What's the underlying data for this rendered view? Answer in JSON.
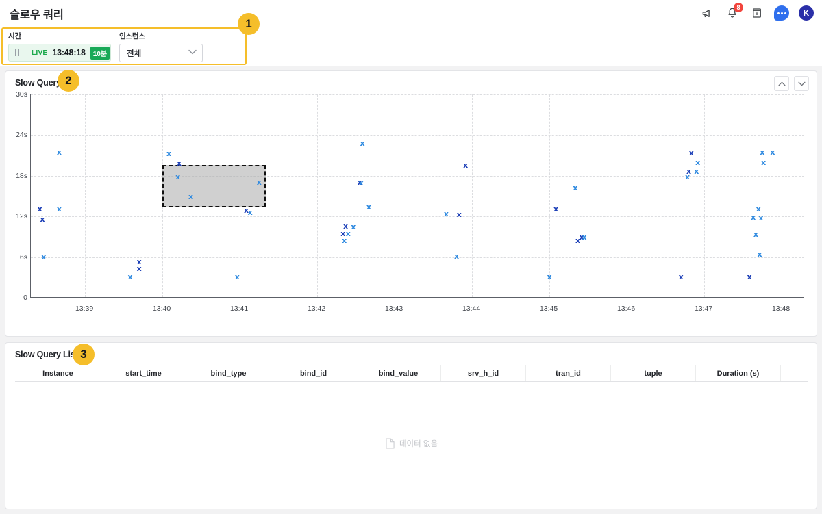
{
  "header": {
    "title": "슬로우 쿼리",
    "icons": [
      {
        "name": "megaphone-icon",
        "glyph": "megaphone"
      },
      {
        "name": "notification-bell-icon",
        "glyph": "bell",
        "badge": "8"
      },
      {
        "name": "guide-book-icon",
        "glyph": "book"
      },
      {
        "name": "chat-icon",
        "glyph": "chat"
      },
      {
        "name": "user-avatar",
        "glyph": "K"
      }
    ]
  },
  "filters": {
    "time": {
      "label": "시간",
      "pause_label": "pause",
      "live_label": "LIVE",
      "current_time": "13:48:18",
      "range_badge": "10분"
    },
    "instance": {
      "label": "인스턴스",
      "value": "전체",
      "options": [
        "전체"
      ]
    }
  },
  "steps": [
    {
      "number": "1"
    },
    {
      "number": "2"
    },
    {
      "number": "3"
    }
  ],
  "chart_panel": {
    "title": "Slow Query",
    "scroll_up_label": "∧",
    "scroll_down_label": "∨"
  },
  "list_panel": {
    "title": "Slow Query List",
    "columns": [
      "Instance",
      "start_time",
      "bind_type",
      "bind_id",
      "bind_value",
      "srv_h_id",
      "tran_id",
      "tuple",
      "Duration (s)",
      ""
    ],
    "empty_text": "데이터 없음"
  },
  "colors": {
    "accent": "#F5BE2A",
    "point_light": "#2f8ae0",
    "point_dark": "#1c3fb7",
    "live_green": "#1ca94c",
    "badge_red": "#f2453d",
    "avatar_blue": "#2a2fa8"
  },
  "chart_data": {
    "type": "scatter",
    "title": "Slow Query",
    "xlabel": "",
    "ylabel": "",
    "grid": true,
    "legend": false,
    "marker": "x",
    "xlim": [
      "13:38:18",
      "13:48:18"
    ],
    "ylim": [
      0,
      30
    ],
    "x_ticks": [
      "13:39",
      "13:40",
      "13:41",
      "13:42",
      "13:43",
      "13:44",
      "13:45",
      "13:46",
      "13:47",
      "13:48"
    ],
    "y_ticks": [
      "0",
      "6s",
      "12s",
      "18s",
      "24s",
      "30s"
    ],
    "y_tick_values": [
      0,
      6,
      12,
      18,
      24,
      30
    ],
    "selection": {
      "x0": "13:40:00",
      "x1": "13:41:20",
      "y0": 13.3,
      "y1": 19.6
    },
    "series": [
      {
        "name": "slow queries",
        "points": [
          {
            "t": "13:38:40",
            "v": 21.5,
            "c": "light"
          },
          {
            "t": "13:38:25",
            "v": 13.1,
            "c": "dark"
          },
          {
            "t": "13:38:40",
            "v": 13.1,
            "c": "light"
          },
          {
            "t": "13:38:27",
            "v": 11.6,
            "c": "dark"
          },
          {
            "t": "13:38:28",
            "v": 6.0,
            "c": "light"
          },
          {
            "t": "13:39:42",
            "v": 5.3,
            "c": "dark"
          },
          {
            "t": "13:39:42",
            "v": 4.3,
            "c": "dark"
          },
          {
            "t": "13:39:35",
            "v": 3.1,
            "c": "light"
          },
          {
            "t": "13:40:05",
            "v": 21.3,
            "c": "light"
          },
          {
            "t": "13:40:13",
            "v": 19.8,
            "c": "dark"
          },
          {
            "t": "13:40:12",
            "v": 17.8,
            "c": "light"
          },
          {
            "t": "13:40:22",
            "v": 14.9,
            "c": "light"
          },
          {
            "t": "13:41:15",
            "v": 17.0,
            "c": "light"
          },
          {
            "t": "13:41:05",
            "v": 12.9,
            "c": "dark"
          },
          {
            "t": "13:41:08",
            "v": 12.6,
            "c": "light"
          },
          {
            "t": "13:40:58",
            "v": 3.1,
            "c": "light"
          },
          {
            "t": "13:42:35",
            "v": 22.8,
            "c": "light"
          },
          {
            "t": "13:42:33",
            "v": 17.0,
            "c": "dark"
          },
          {
            "t": "13:42:34",
            "v": 16.9,
            "c": "light"
          },
          {
            "t": "13:42:40",
            "v": 13.4,
            "c": "light"
          },
          {
            "t": "13:42:22",
            "v": 10.6,
            "c": "dark"
          },
          {
            "t": "13:42:28",
            "v": 10.5,
            "c": "light"
          },
          {
            "t": "13:42:20",
            "v": 9.4,
            "c": "dark"
          },
          {
            "t": "13:42:24",
            "v": 9.4,
            "c": "light"
          },
          {
            "t": "13:42:21",
            "v": 8.4,
            "c": "light"
          },
          {
            "t": "13:43:55",
            "v": 19.5,
            "c": "dark"
          },
          {
            "t": "13:43:40",
            "v": 12.4,
            "c": "light"
          },
          {
            "t": "13:43:50",
            "v": 12.3,
            "c": "dark"
          },
          {
            "t": "13:43:48",
            "v": 6.1,
            "c": "light"
          },
          {
            "t": "13:45:00",
            "v": 3.1,
            "c": "light"
          },
          {
            "t": "13:45:20",
            "v": 16.2,
            "c": "light"
          },
          {
            "t": "13:45:05",
            "v": 13.1,
            "c": "dark"
          },
          {
            "t": "13:45:25",
            "v": 8.9,
            "c": "dark"
          },
          {
            "t": "13:45:27",
            "v": 8.9,
            "c": "light"
          },
          {
            "t": "13:45:22",
            "v": 8.4,
            "c": "dark"
          },
          {
            "t": "13:46:50",
            "v": 21.4,
            "c": "dark"
          },
          {
            "t": "13:46:55",
            "v": 19.9,
            "c": "light"
          },
          {
            "t": "13:46:48",
            "v": 18.6,
            "c": "dark"
          },
          {
            "t": "13:46:54",
            "v": 18.6,
            "c": "light"
          },
          {
            "t": "13:46:47",
            "v": 17.8,
            "c": "light"
          },
          {
            "t": "13:46:42",
            "v": 3.1,
            "c": "dark"
          },
          {
            "t": "13:47:45",
            "v": 21.5,
            "c": "light"
          },
          {
            "t": "13:47:53",
            "v": 21.5,
            "c": "light"
          },
          {
            "t": "13:47:46",
            "v": 19.9,
            "c": "light"
          },
          {
            "t": "13:47:42",
            "v": 13.1,
            "c": "light"
          },
          {
            "t": "13:47:38",
            "v": 11.9,
            "c": "light"
          },
          {
            "t": "13:47:44",
            "v": 11.8,
            "c": "light"
          },
          {
            "t": "13:47:40",
            "v": 9.3,
            "c": "light"
          },
          {
            "t": "13:47:43",
            "v": 6.4,
            "c": "light"
          },
          {
            "t": "13:47:35",
            "v": 3.1,
            "c": "dark"
          }
        ]
      }
    ]
  }
}
